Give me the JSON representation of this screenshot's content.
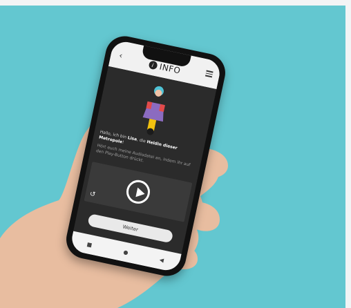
{
  "app": {
    "header": {
      "title": "INFO",
      "back_icon": "chevron-left-icon",
      "menu_icon": "hamburger-icon",
      "info_icon": "info-icon"
    },
    "intro": {
      "greeting_prefix": "Hallo, ich bin ",
      "name": "Lisa",
      "greeting_middle": ", die ",
      "role": "Heldin dieser Metropole",
      "greeting_suffix": "!",
      "instruction": "Hört euch meine Audiodatei an, indem ihr auf den Play-Button drückt."
    },
    "player": {
      "play_icon": "play-icon",
      "replay_icon": "replay-icon"
    },
    "actions": {
      "continue_label": "Weiter"
    },
    "system_nav": {
      "icons": [
        "square-icon",
        "circle-icon",
        "triangle-icon"
      ]
    }
  },
  "colors": {
    "background": "#63c7d0",
    "phone_screen": "#2b2b2b",
    "header_bg": "#f1f1f1",
    "button_bg": "#e9e9e9"
  }
}
